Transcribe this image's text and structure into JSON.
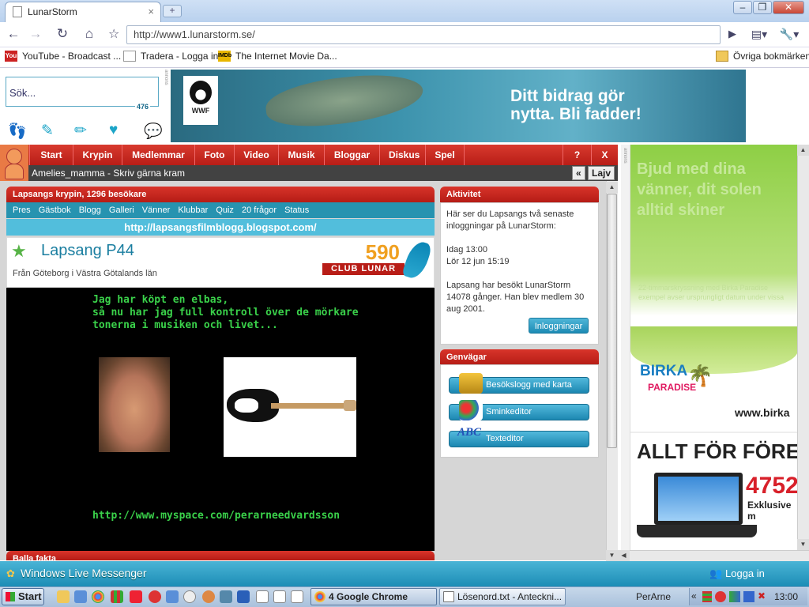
{
  "browser": {
    "tab_title": "LunarStorm",
    "tab_close": "×",
    "new_tab": "+",
    "url": "http://www1.lunarstorm.se/",
    "window_buttons": [
      "–",
      "❐",
      "✕"
    ],
    "bookmarks": [
      {
        "label": "YouTube - Broadcast ...",
        "icon": "youtube-icon",
        "color": "#cc2222",
        "badge": "You"
      },
      {
        "label": "Tradera - Logga in",
        "icon": "document-icon",
        "color": "#ffffff",
        "badge": ""
      },
      {
        "label": "The Internet Movie Da...",
        "icon": "imdb-icon",
        "color": "#e8b600",
        "badge": "IMDb"
      }
    ],
    "other_bookmarks": "Övriga bokmärken"
  },
  "site": {
    "search_placeholder": "Sök...",
    "search_count": "476",
    "ad_label": "annons",
    "banner": {
      "logo_text": "WWF",
      "text_line1": "Ditt bidrag gör",
      "text_line2": "nytta. Bli fadder!"
    },
    "nav": [
      "Start",
      "Krypin",
      "Medlemmar",
      "Foto",
      "Video",
      "Musik",
      "Bloggar",
      "Diskus",
      "Spel",
      "?",
      "X"
    ],
    "status_text": "Amelies_mamma - Skriv gärna kram",
    "back_symbol": "«",
    "lajv": "Lajv"
  },
  "krypin": {
    "header": "Lapsangs krypin, 1296 besökare",
    "subnav": [
      "Pres",
      "Gästbok",
      "Blogg",
      "Galleri",
      "Vänner",
      "Klubbar",
      "Quiz",
      "20 frågor",
      "Status"
    ],
    "blog_url": "http://lapsangsfilmblogg.blogspot.com/",
    "name": "Lapsang P44",
    "location": "Från Göteborg i Västra Götalands län",
    "points": "590",
    "club": "CLUB LUNAR",
    "post_text": "Jag har köpt en elbas,\nså nu har jag full kontroll över de mörkare tonerna i musiken och livet...",
    "myspace": "http://www.myspace.com/perarneedvardsson",
    "balla_header": "Balla fakta"
  },
  "aktivitet": {
    "header": "Aktivitet",
    "intro": "Här ser du Lapsangs två senaste inloggningar på LunarStorm:",
    "login1": "Idag 13:00",
    "login2": "Lör 12 jun 15:19",
    "visits": "Lapsang har besökt LunarStorm 14078 gånger. Han blev medlem 30 aug 2001.",
    "button": "Inloggningar"
  },
  "genvagar": {
    "header": "Genvägar",
    "items": [
      {
        "label": "Besökslogg med karta",
        "icon": "book-icon"
      },
      {
        "label": "Sminkeditor",
        "icon": "palette-icon"
      },
      {
        "label": "Texteditor",
        "icon": "abc-icon"
      }
    ]
  },
  "ads": {
    "birka_big": "Bjud med dina vänner, dit solen alltid skiner",
    "birka_small": "22-timmarskryssning med Birka Paradise exempel avser ursprungligt datum under vissa",
    "birka_logo": "BIRKA",
    "birka_logo_sub": "PARADISE",
    "birka_url": "www.birka",
    "company_title": "ALLT FÖR FÖRETAG",
    "company_price": "4752",
    "company_note": "Exklusive m"
  },
  "messenger": {
    "name": "Windows Live Messenger",
    "login": "Logga in"
  },
  "taskbar": {
    "start": "Start",
    "tasks": [
      "4 Google Chrome",
      "Lösenord.txt - Anteckni..."
    ],
    "user": "PerArne",
    "tray_arrow": "«",
    "clock": "13:00"
  },
  "colors": {
    "red": "#c4231b",
    "teal": "#2793b0",
    "green_text": "#3ad14a"
  }
}
